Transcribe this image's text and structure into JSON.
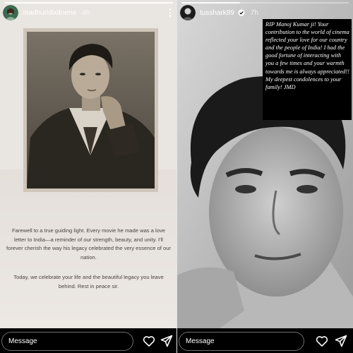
{
  "left_story": {
    "username": "madhuridixitnene",
    "time": "4h",
    "progress": 1.0,
    "tribute_paragraph_1": "Farewell to a true guiding light. Every movie he made was a love letter to India—a reminder of our strength, beauty, and unity. I'll forever cherish the way his legacy celebrated the very essence of our nation.",
    "tribute_paragraph_2": "Today, we celebrate your life and the beautiful legacy you leave behind. Rest in peace sir.",
    "message_placeholder": "Message"
  },
  "right_story": {
    "username": "tusshark89",
    "time": "7h",
    "progress": 0.35,
    "caption": "RIP Manoj Kumar ji! Your contribution to the world of cinema reflected your love for our country and the people of India! I had the good fortune of interacting with you a few times and your warmth towards me is always appreciated!! My deepest condolences to your family! JMD",
    "message_placeholder": "Message"
  },
  "colors": {
    "left_background": "#e9e5e1",
    "tribute_text": "#4a4440",
    "bottom_bar": "#000000"
  },
  "icons": [
    "more-icon",
    "verified-icon",
    "heart-icon",
    "share-icon"
  ]
}
